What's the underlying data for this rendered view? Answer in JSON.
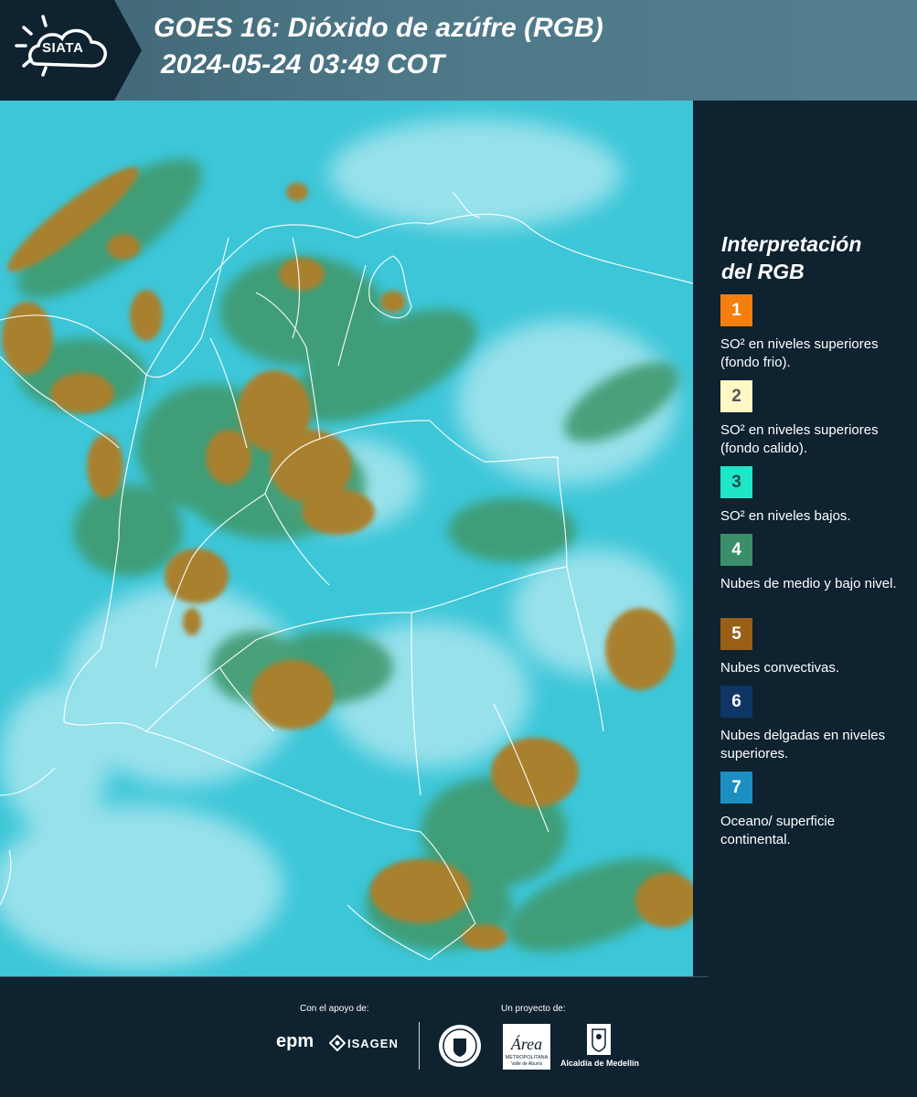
{
  "header": {
    "logo_text": "SIATA",
    "title_line1": "GOES 16: Dióxido de azúfre (RGB)",
    "title_line2": "2024-05-24 03:49 COT"
  },
  "legend": {
    "title_line1": "Interpretación",
    "title_line2": "del RGB",
    "items": [
      {
        "number": "1",
        "color": "#f47f0e",
        "text_color": "#ffffff",
        "description": "SO² en niveles superiores (fondo frio)."
      },
      {
        "number": "2",
        "color": "#fff8c4",
        "text_color": "#555555",
        "description": "SO² en niveles superiores (fondo calido)."
      },
      {
        "number": "3",
        "color": "#1ee6c6",
        "text_color": "#0e4e4a",
        "description": "SO² en niveles bajos."
      },
      {
        "number": "4",
        "color": "#3a8f6a",
        "text_color": "#ffffff",
        "description": "Nubes de medio y bajo nivel."
      },
      {
        "number": "5",
        "color": "#9a5f17",
        "text_color": "#ffffff",
        "description": "Nubes convectivas."
      },
      {
        "number": "6",
        "color": "#0f3564",
        "text_color": "#ffffff",
        "description": "Nubes delgadas en niveles superiores."
      },
      {
        "number": "7",
        "color": "#1c8fc2",
        "text_color": "#ffffff",
        "description": "Oceano/ superficie continental."
      }
    ]
  },
  "footer": {
    "support_label": "Con el apoyo de:",
    "project_label": "Un proyecto de:",
    "epm_logo": "epm",
    "isagen_logo": "ISAGEN",
    "area_logo": "Área",
    "area_sub": "METROPOLITANA",
    "area_sub2": "Valle de Aburrá",
    "alcaldia_logo": "Alcaldía de Medellín"
  },
  "map_colors": {
    "background": "#3cc6d8",
    "haze": "#a8e6ef",
    "green_cloud": "#3f9a6e",
    "convective": "#a9802d",
    "border": "#ffffff"
  }
}
